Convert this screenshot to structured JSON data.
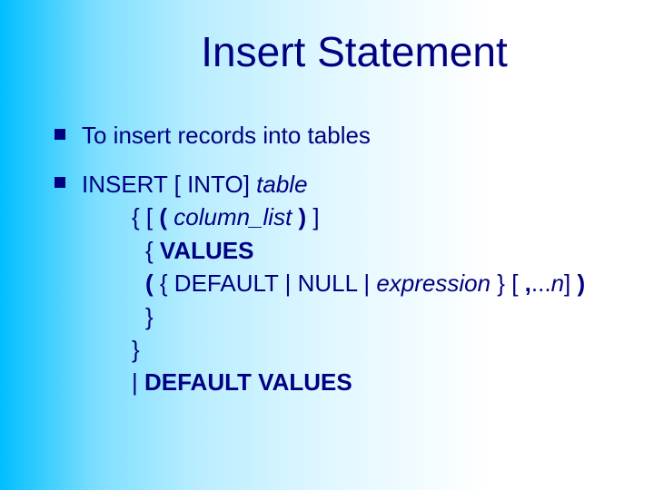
{
  "title": "Insert Statement",
  "bullet1": "To insert records into tables",
  "syntax": {
    "l1_a": "INSERT [ INTO]",
    "l1_b": " table",
    "l2_a": "{    [ ",
    "l2_b": "( ",
    "l2_c": "column_list",
    "l2_d": " ) ",
    "l2_e": "]",
    "l3_a": "{ ",
    "l3_b": "VALUES",
    "l4_a": "( ",
    "l4_b": "{ DEFAULT | NULL | ",
    "l4_c": "expression",
    "l4_d": " } [ ",
    "l4_e": ",",
    "l4_f": "...",
    "l4_g": "n",
    "l4_h": "] ",
    "l4_i": ")",
    "l5": "}",
    "l6": "}",
    "l7_a": "| ",
    "l7_b": "DEFAULT VALUES"
  }
}
